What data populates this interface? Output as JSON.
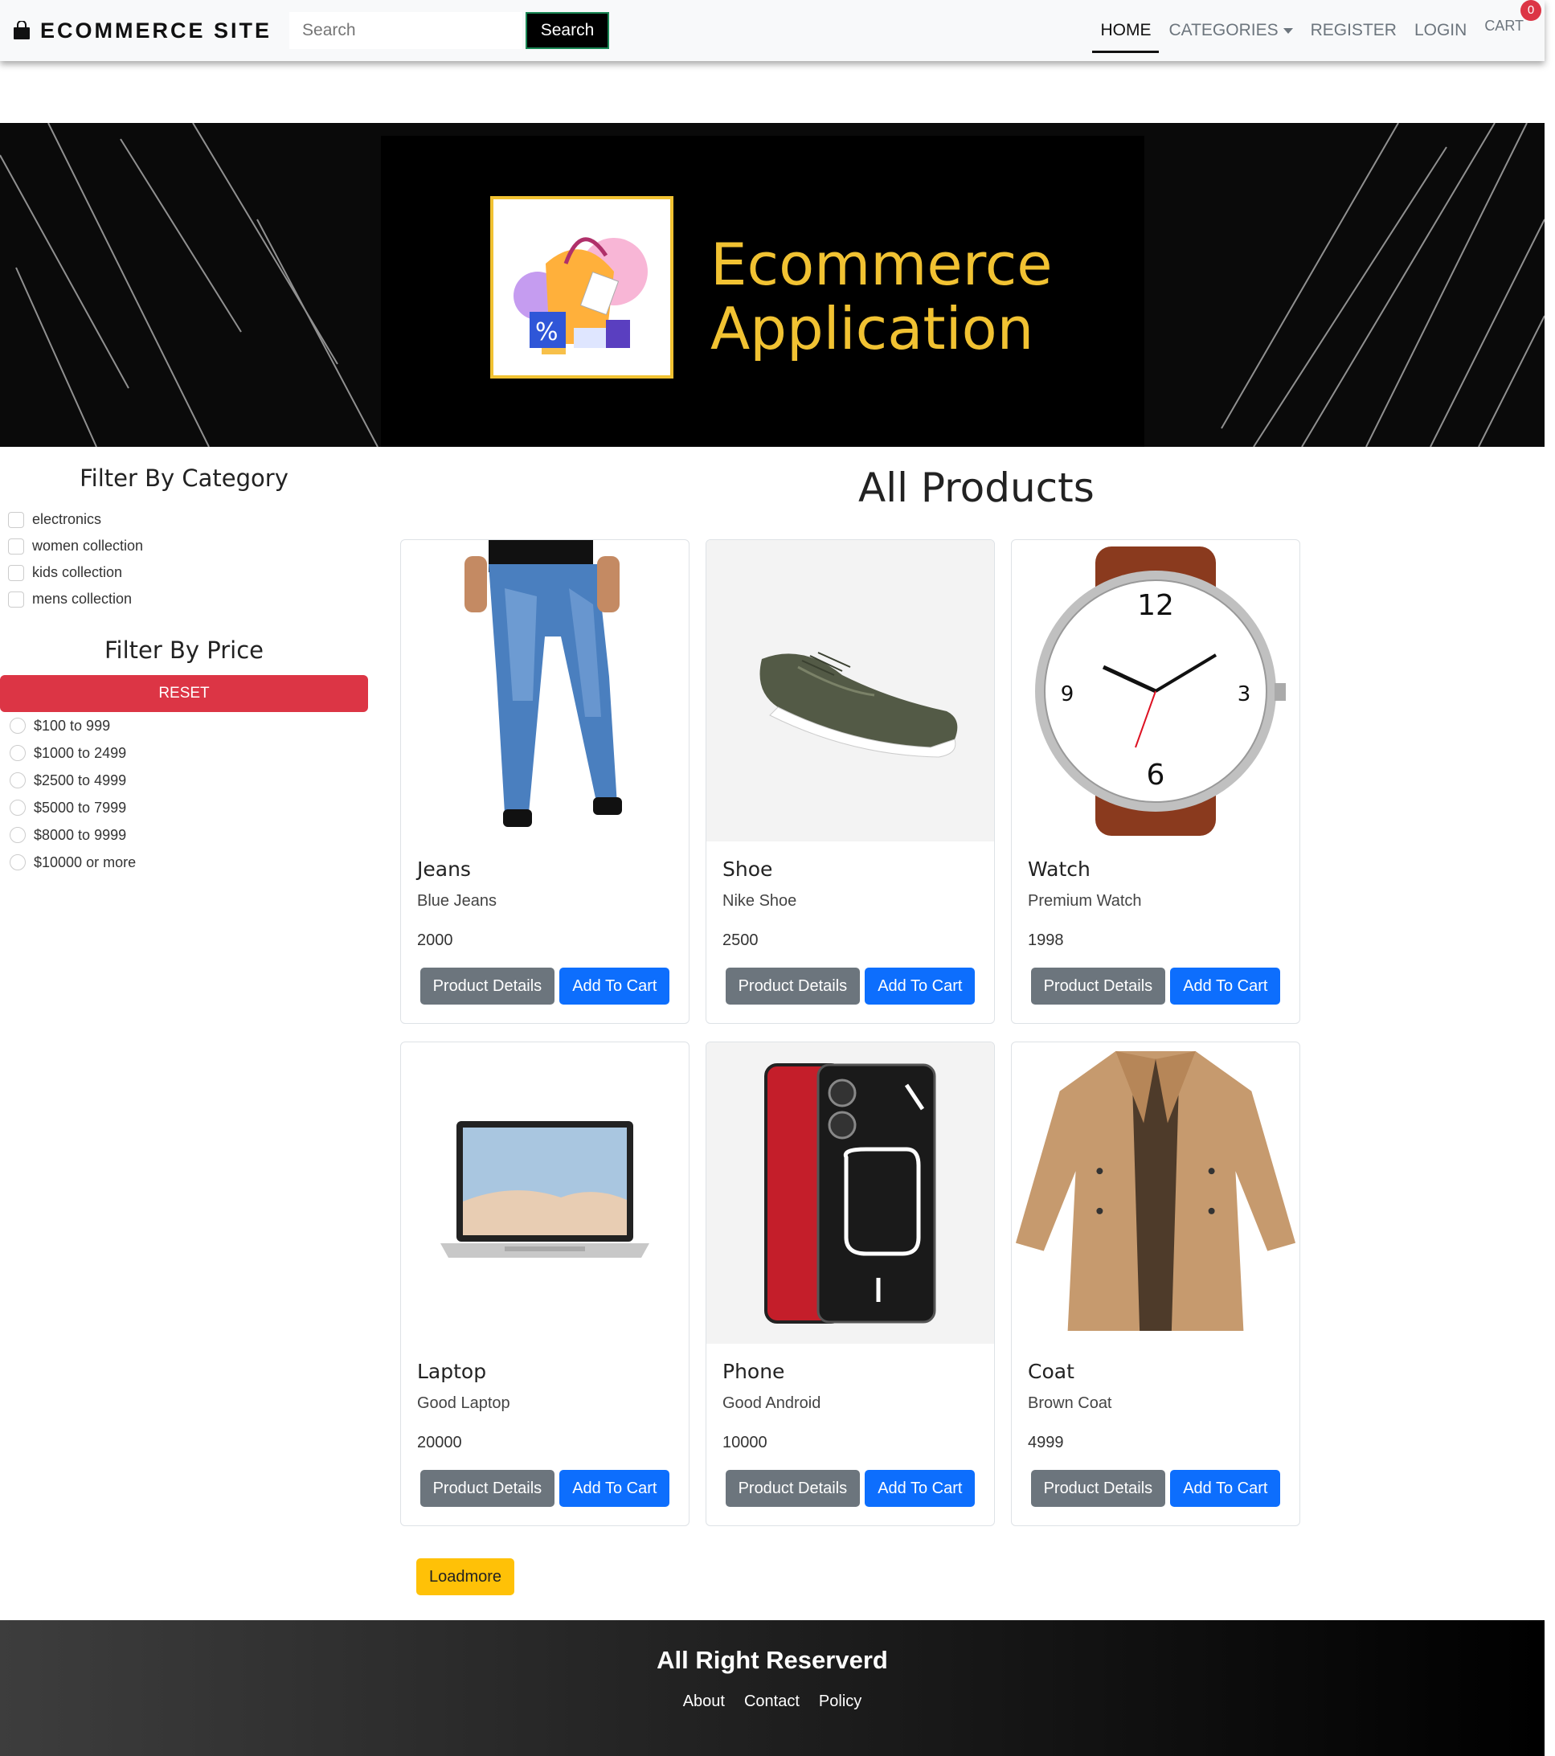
{
  "navbar": {
    "brand": "ECOMMERCE SITE",
    "search_placeholder": "Search",
    "search_button": "Search",
    "links": {
      "home": "HOME",
      "categories": "CATEGORIES",
      "register": "REGISTER",
      "login": "LOGIN"
    },
    "cart_label": "CART",
    "cart_count": "0"
  },
  "banner": {
    "line1": "Ecommerce",
    "line2": "Application"
  },
  "sidebar": {
    "category_title": "Filter By Category",
    "categories": [
      "electronics",
      "women collection",
      "kids collection",
      "mens collection"
    ],
    "price_title": "Filter By Price",
    "reset_label": "RESET",
    "prices": [
      "$100 to 999",
      "$1000 to 2499",
      "$2500 to 4999",
      "$5000 to 7999",
      "$8000 to 9999",
      "$10000 or more"
    ]
  },
  "main": {
    "title": "All Products",
    "details_label": "Product Details",
    "cart_label": "Add To Cart",
    "loadmore_label": "Loadmore",
    "products": [
      {
        "name": "Jeans",
        "desc": "Blue Jeans",
        "price": "2000"
      },
      {
        "name": "Shoe",
        "desc": "Nike Shoe",
        "price": "2500"
      },
      {
        "name": "Watch",
        "desc": "Premium Watch",
        "price": "1998"
      },
      {
        "name": "Laptop",
        "desc": "Good Laptop",
        "price": "20000"
      },
      {
        "name": "Phone",
        "desc": "Good Android",
        "price": "10000"
      },
      {
        "name": "Coat",
        "desc": "Brown Coat",
        "price": "4999"
      }
    ]
  },
  "footer": {
    "title": "All Right Reserverd",
    "links": [
      "About",
      "Contact",
      "Policy"
    ]
  },
  "colors": {
    "accent": "#0d6efd",
    "danger": "#dc3545",
    "warning": "#ffc107",
    "secondary": "#6c757d",
    "gold": "#f1c232"
  }
}
